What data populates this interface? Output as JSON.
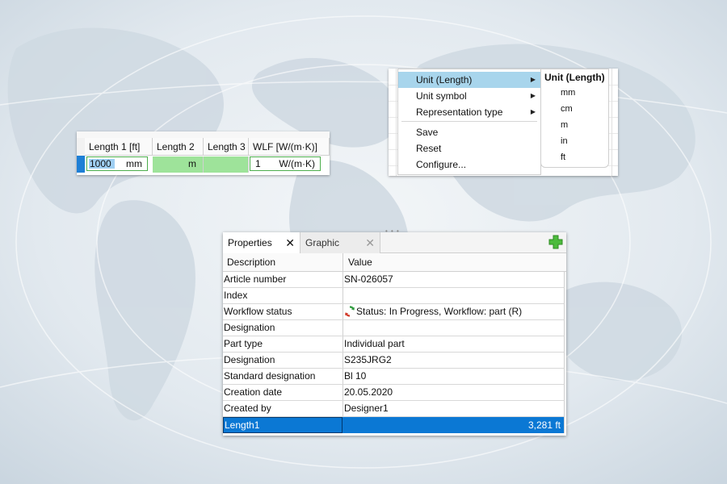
{
  "grid": {
    "columns": [
      "Length 1 [ft]",
      "Length 2",
      "Length 3",
      "WLF [W/(m·K)]"
    ],
    "row": {
      "length1_value": "1000",
      "length1_unit": "mm",
      "length2_unit": "m",
      "wlf_value": "1",
      "wlf_unit": "W/(m·K)"
    }
  },
  "context_menu": {
    "items": [
      {
        "label": "Unit (Length)",
        "submenu": true,
        "active": true
      },
      {
        "label": "Unit symbol",
        "submenu": true
      },
      {
        "label": "Representation type",
        "submenu": true
      },
      {
        "label": "Save"
      },
      {
        "label": "Reset"
      },
      {
        "label": "Configure..."
      }
    ],
    "submenu": {
      "title": "Unit (Length)",
      "options": [
        "mm",
        "cm",
        "m",
        "in",
        "ft"
      ]
    }
  },
  "properties": {
    "tabs": [
      {
        "label": "Properties",
        "active": true
      },
      {
        "label": "Graphic",
        "active": false
      }
    ],
    "header": {
      "description": "Description",
      "value": "Value"
    },
    "rows": [
      {
        "key": "Article number",
        "value": "SN-026057"
      },
      {
        "key": "Index",
        "value": ""
      },
      {
        "key": "Workflow status",
        "value": "Status: In Progress, Workflow: part (R)",
        "icon": "workflow-refresh-icon"
      },
      {
        "key": "Designation",
        "value": ""
      },
      {
        "key": "Part type",
        "value": "Individual part"
      },
      {
        "key": "Designation",
        "value": "S235JRG2"
      },
      {
        "key": "Standard designation",
        "value": "Bl 10"
      },
      {
        "key": "Creation date",
        "value": "20.05.2020"
      },
      {
        "key": "Created by",
        "value": "Designer1"
      },
      {
        "key": "Length1",
        "value": "3,281 ft",
        "selected": true
      }
    ]
  },
  "colors": {
    "selection": "#0b78d4",
    "menu_highlight": "#a8d5ec",
    "cell_green": "#9ee39a",
    "add_icon": "#4cbb3c"
  }
}
